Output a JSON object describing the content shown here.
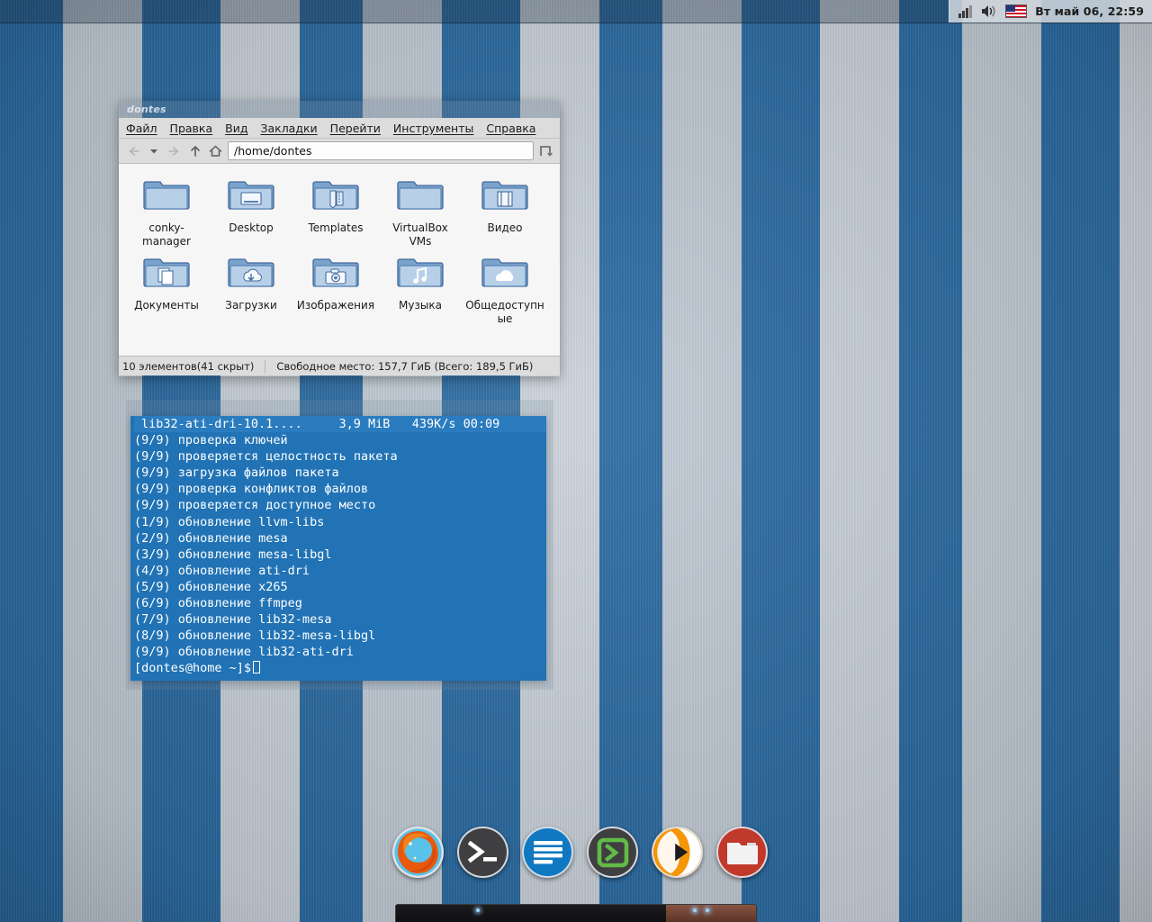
{
  "panel": {
    "clock": "Вт май 06, 22:59",
    "icons": [
      "signal-icon",
      "volume-icon",
      "keyboard-layout-flag"
    ],
    "layout": "US"
  },
  "filemanager": {
    "title": "dontes",
    "menu": [
      "Файл",
      "Правка",
      "Вид",
      "Закладки",
      "Перейти",
      "Инструменты",
      "Справка"
    ],
    "toolbar": {
      "back": "back-icon",
      "history": "chevron-down-icon",
      "forward": "forward-icon",
      "up": "up-icon",
      "home": "home-icon",
      "split": "split-view-icon"
    },
    "path": "/home/dontes",
    "items": [
      {
        "label": "conky-manager",
        "icon": "folder"
      },
      {
        "label": "Desktop",
        "icon": "folder-desktop"
      },
      {
        "label": "Templates",
        "icon": "folder-templates"
      },
      {
        "label": "VirtualBox VMs",
        "icon": "folder"
      },
      {
        "label": "Видео",
        "icon": "folder-videos"
      },
      {
        "label": "Документы",
        "icon": "folder-documents"
      },
      {
        "label": "Загрузки",
        "icon": "folder-downloads"
      },
      {
        "label": "Изображения",
        "icon": "folder-pictures"
      },
      {
        "label": "Музыка",
        "icon": "folder-music"
      },
      {
        "label": "Общедоступные",
        "icon": "folder-public"
      }
    ],
    "status": {
      "count": "10 элементов(41 скрыт)",
      "space": "Свободное место: 157,7 ГиБ (Всего: 189,5 ГиБ)"
    }
  },
  "terminal": {
    "header": "lib32-ati-dri-10.1....     3,9 MiB   439K/s 00:09",
    "lines": [
      "(9/9) проверка ключей",
      "(9/9) проверяется целостность пакета",
      "(9/9) загрузка файлов пакета",
      "(9/9) проверка конфликтов файлов",
      "(9/9) проверяется доступное место",
      "(1/9) обновление llvm-libs",
      "(2/9) обновление mesa",
      "(3/9) обновление mesa-libgl",
      "(4/9) обновление ati-dri",
      "(5/9) обновление x265",
      "(6/9) обновление ffmpeg",
      "(7/9) обновление lib32-mesa",
      "(8/9) обновление lib32-mesa-libgl",
      "(9/9) обновление lib32-ati-dri"
    ],
    "prompt": "[dontes@home ~]$"
  },
  "dock": {
    "items": [
      {
        "name": "firefox",
        "label": "Firefox"
      },
      {
        "name": "terminal",
        "label": "Terminal"
      },
      {
        "name": "text-editor",
        "label": "Text Editor"
      },
      {
        "name": "remote-desktop",
        "label": "Remote Desktop"
      },
      {
        "name": "media-player",
        "label": "Media Player"
      },
      {
        "name": "file-manager",
        "label": "File Manager"
      }
    ]
  },
  "colors": {
    "wallpaper_blue": "#2a6ba3",
    "wallpaper_light": "#c6cfd8",
    "terminal_bg": "#2173b5",
    "panel_bg": "#1c2e40"
  }
}
